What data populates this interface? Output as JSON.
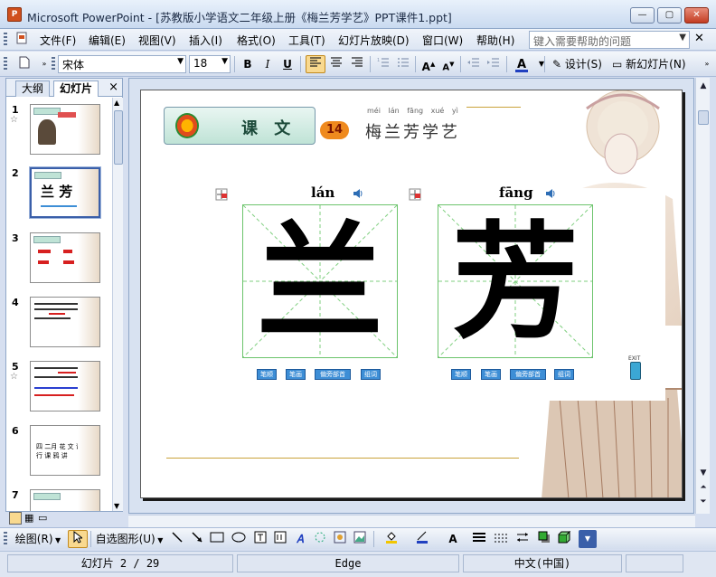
{
  "window": {
    "title": "Microsoft PowerPoint - [苏教版小学语文二年级上册《梅兰芳学艺》PPT课件1.ppt]",
    "app_icon": "P"
  },
  "menu": {
    "items": [
      "文件(F)",
      "编辑(E)",
      "视图(V)",
      "插入(I)",
      "格式(O)",
      "工具(T)",
      "幻灯片放映(D)",
      "窗口(W)",
      "帮助(H)"
    ],
    "help_placeholder": "键入需要帮助的问题"
  },
  "toolbar": {
    "font": "宋体",
    "size": "18",
    "bold": "B",
    "italic": "I",
    "underline": "U",
    "font_color": "A",
    "design_label": "设计(S)",
    "new_slide_label": "新幻灯片(N)"
  },
  "pane": {
    "tabs": [
      "大纲",
      "幻灯片"
    ],
    "close": "×",
    "thumbnails": [
      {
        "num": "1",
        "star": true
      },
      {
        "num": "2",
        "star": false,
        "selected": true
      },
      {
        "num": "3",
        "star": false
      },
      {
        "num": "4",
        "star": false
      },
      {
        "num": "5",
        "star": true
      },
      {
        "num": "6",
        "star": false
      },
      {
        "num": "7",
        "star": false
      }
    ],
    "thumb_texts": {
      "t6_line1": "四 二月 花 文 课",
      "t6_line2": "行 课 鸦 讲"
    }
  },
  "slide": {
    "band_label": "课 文",
    "lesson_number": "14",
    "lesson_title": "梅兰芳学艺",
    "lesson_pinyin": "méi lán fāng xué yì",
    "char1": {
      "char": "兰",
      "pinyin": "lán",
      "buttons": [
        "笔顺",
        "笔画",
        "偏旁部首",
        "组词"
      ]
    },
    "char2": {
      "char": "芳",
      "pinyin": "fāng",
      "buttons": [
        "笔顺",
        "笔画",
        "偏旁部首",
        "组词"
      ]
    },
    "exit_label": "EXIT"
  },
  "drawbar": {
    "draw_label": "绘图(R)",
    "autoshape_label": "自选图形(U)"
  },
  "status": {
    "slide_info": "幻灯片 2 / 29",
    "design": "Edge",
    "language": "中文(中国)"
  },
  "colors": {
    "accent": "#3a5fa9",
    "grid_green": "#6cc46c",
    "lesson_orange": "#ef8a1e"
  }
}
